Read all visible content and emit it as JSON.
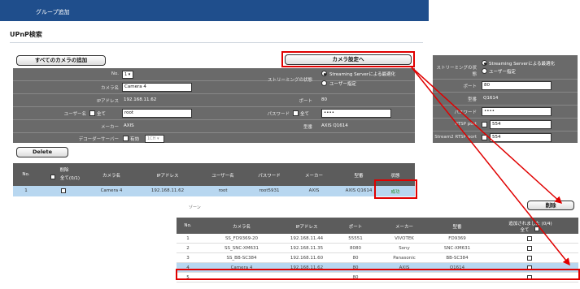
{
  "header": {
    "tab_label": "グループ追加"
  },
  "section": {
    "title": "UPnP検索"
  },
  "buttons": {
    "add_all": "すべてのカメラの追加",
    "camera_settings": "カメラ設定へ",
    "delete": "Delete",
    "delete_jp": "削除"
  },
  "form": {
    "no_label": "No.",
    "no_value": "1",
    "camera_name_label": "カメラ名",
    "camera_name_value": "Camera 4",
    "streaming_label": "ストリーミングの状態",
    "streaming_opt1": "Streaming Serverによる最適化",
    "streaming_opt2": "ユーザー指定",
    "ip_label": "IPアドレス",
    "ip_value": "192.168.11.62",
    "port_label": "ポート",
    "port_value": "80",
    "user_label": "ユーザー名",
    "user_all": "全て",
    "user_value": "root",
    "password_label": "パスワード",
    "password_all": "全て",
    "password_value": "••••",
    "maker_label": "メーカー",
    "maker_value": "AXIS",
    "model_label": "型番",
    "model_value": "AXIS Q1614",
    "decoder_label": "デコーダーサーバー",
    "decoder_check": "有効",
    "decoder_select": "1CH"
  },
  "camera_table": {
    "headers": [
      "No.",
      "削除",
      "カメラ名",
      "IPアドレス",
      "ユーザー名",
      "パスワード",
      "メーカー",
      "型番",
      "状態"
    ],
    "delete_sub": "全て(0/1)",
    "row": {
      "no": "1",
      "name": "Camera 4",
      "ip": "192.168.11.62",
      "user": "root",
      "password": "root5931",
      "maker": "AXIS",
      "model": "AXIS Q1614",
      "status": "成功"
    }
  },
  "right_panel": {
    "streaming_label": "ストリーミングの状態",
    "opt1": "Streaming Serverによる最適化",
    "opt2": "ユーザー指定",
    "port_label": "ポート",
    "port_value": "80",
    "model_label": "型番",
    "model_value": "Q1614",
    "password_label": "パスワード",
    "password_value": "••••",
    "rtsp_label": "RTSP port",
    "rtsp_value": "554",
    "stream2_label": "Stream2 RTSP port",
    "stream2_value": "554"
  },
  "list_table": {
    "small_label": "ゾーン",
    "headers": [
      "No.",
      "カメラ名",
      "IPアドレス",
      "ポート",
      "メーカー",
      "型番",
      "追加されました (0/4)"
    ],
    "all_label": "全て",
    "rows": [
      {
        "no": "1",
        "name": "SS_FD9369-20",
        "ip": "192.168.11.44",
        "port": "55551",
        "maker": "VIVOTEK",
        "model": "FD9369"
      },
      {
        "no": "2",
        "name": "SS_SNC-XM631",
        "ip": "192.168.11.35",
        "port": "8080",
        "maker": "Sony",
        "model": "SNC-XM631"
      },
      {
        "no": "3",
        "name": "SS_BB-SC384",
        "ip": "192.168.11.60",
        "port": "80",
        "maker": "Panasonic",
        "model": "BB-SC384"
      },
      {
        "no": "4",
        "name": "Camera 4",
        "ip": "192.168.11.62",
        "port": "80",
        "maker": "AXIS",
        "model": "Q1614"
      },
      {
        "no": "5",
        "name": "",
        "ip": "",
        "port": "80",
        "maker": "",
        "model": ""
      }
    ]
  },
  "colors": {
    "accent": "#1f4e8c",
    "highlight": "#e00000",
    "row_select": "#b8d7f0"
  }
}
